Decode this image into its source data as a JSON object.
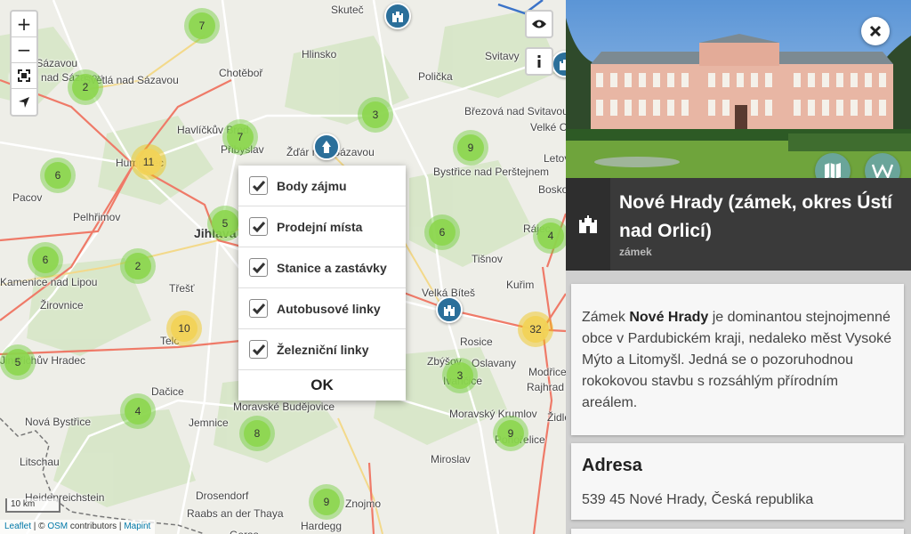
{
  "map": {
    "towns": [
      {
        "name": "Skuteč",
        "cls": ""
      },
      {
        "name": "nad Sázavou",
        "cls": ""
      },
      {
        "name": "Ledeč nad Sázavou",
        "cls": ""
      },
      {
        "name": "Světlá nad Sázavou",
        "cls": ""
      },
      {
        "name": "Chotěboř",
        "cls": ""
      },
      {
        "name": "Hlinsko",
        "cls": ""
      },
      {
        "name": "Polička",
        "cls": ""
      },
      {
        "name": "Svitavy",
        "cls": ""
      },
      {
        "name": "Havlíčkův Brod",
        "cls": ""
      },
      {
        "name": "Přibyslav",
        "cls": ""
      },
      {
        "name": "Žďár nad Sázavou",
        "cls": ""
      },
      {
        "name": "Březová nad Svitavou",
        "cls": ""
      },
      {
        "name": "Velké Opatovice",
        "cls": ""
      },
      {
        "name": "Humpolec",
        "cls": ""
      },
      {
        "name": "Bystřice nad Perštejnem",
        "cls": ""
      },
      {
        "name": "Letovice",
        "cls": ""
      },
      {
        "name": "Boskovice",
        "cls": ""
      },
      {
        "name": "Pacov",
        "cls": ""
      },
      {
        "name": "Pelhřimov",
        "cls": ""
      },
      {
        "name": "Jihlava",
        "cls": "big"
      },
      {
        "name": "Rájec",
        "cls": ""
      },
      {
        "name": "Tišnov",
        "cls": ""
      },
      {
        "name": "Kamenice nad Lipou",
        "cls": ""
      },
      {
        "name": "Žirovnice",
        "cls": ""
      },
      {
        "name": "Třešť",
        "cls": ""
      },
      {
        "name": "Velká Bíteš",
        "cls": ""
      },
      {
        "name": "Kuřim",
        "cls": ""
      },
      {
        "name": "Telč",
        "cls": ""
      },
      {
        "name": "Rosice",
        "cls": ""
      },
      {
        "name": "Jindřichův Hradec",
        "cls": ""
      },
      {
        "name": "Zbýšov",
        "cls": ""
      },
      {
        "name": "Oslavany",
        "cls": ""
      },
      {
        "name": "Modřice",
        "cls": ""
      },
      {
        "name": "Rajhrad",
        "cls": ""
      },
      {
        "name": "Dačice",
        "cls": ""
      },
      {
        "name": "Ivančice",
        "cls": ""
      },
      {
        "name": "Moravské Budějovice",
        "cls": ""
      },
      {
        "name": "Moravský Krumlov",
        "cls": ""
      },
      {
        "name": "Židlochovice",
        "cls": ""
      },
      {
        "name": "Nová Bystřice",
        "cls": ""
      },
      {
        "name": "Jemnice",
        "cls": ""
      },
      {
        "name": "Pohořelice",
        "cls": ""
      },
      {
        "name": "Litschau",
        "cls": ""
      },
      {
        "name": "Miroslav",
        "cls": ""
      },
      {
        "name": "Heidenreichstein",
        "cls": ""
      },
      {
        "name": "Drosendorf",
        "cls": ""
      },
      {
        "name": "Znojmo",
        "cls": ""
      },
      {
        "name": "Raabs an der Thaya",
        "cls": ""
      },
      {
        "name": "Hardegg",
        "cls": ""
      },
      {
        "name": "Geras",
        "cls": ""
      }
    ],
    "clusters": [
      {
        "count": "7",
        "color": "green"
      },
      {
        "count": "2",
        "color": "green"
      },
      {
        "count": "3",
        "color": "green"
      },
      {
        "count": "7",
        "color": "green"
      },
      {
        "count": "9",
        "color": "green"
      },
      {
        "count": "11",
        "color": "yellow"
      },
      {
        "count": "6",
        "color": "green"
      },
      {
        "count": "5",
        "color": "green"
      },
      {
        "count": "6",
        "color": "green"
      },
      {
        "count": "4",
        "color": "green"
      },
      {
        "count": "6",
        "color": "green"
      },
      {
        "count": "2",
        "color": "green"
      },
      {
        "count": "10",
        "color": "yellow"
      },
      {
        "count": "32",
        "color": "yellow"
      },
      {
        "count": "5",
        "color": "green"
      },
      {
        "count": "3",
        "color": "green"
      },
      {
        "count": "4",
        "color": "green"
      },
      {
        "count": "8",
        "color": "green"
      },
      {
        "count": "9",
        "color": "green"
      },
      {
        "count": "9",
        "color": "green"
      }
    ],
    "zoom_in": "+",
    "zoom_out": "−",
    "scale": "10 km",
    "attribution": {
      "leaflet": "Leaflet",
      "sep": " | © ",
      "osm": "OSM",
      "contributors": " contributors",
      "sep2": " | ",
      "mapint": "Mapint"
    }
  },
  "layers_popup": {
    "items": [
      {
        "label": "Body zájmu",
        "checked": true
      },
      {
        "label": "Prodejní místa",
        "checked": true
      },
      {
        "label": "Stanice a zastávky",
        "checked": true
      },
      {
        "label": "Autobusové linky",
        "checked": true
      },
      {
        "label": "Železniční linky",
        "checked": true
      }
    ],
    "ok": "OK"
  },
  "detail": {
    "title": "Nové Hrady (zámek, okres Ústí nad Orlicí)",
    "subtitle": "zámek",
    "description": {
      "before": "Zámek ",
      "bold": "Nové Hrady",
      "after": " je dominantou stejnojmenné obce v Pardubickém kraji, nedaleko měst Vysoké Mýto a Litomyšl. Jedná se o pozoruhodnou rokokovou stavbu s rozsáhlým přírodním areálem."
    },
    "address_heading": "Adresa",
    "address": "539 45 Nové Hrady, Česká republika"
  },
  "colors": {
    "rail": "#ef7a68",
    "cluster_green": "#8cd64e",
    "cluster_yellow": "#f1d357",
    "poi": "#2b6f9a",
    "panel": "#3a3a3a",
    "accent": "#6aa59a"
  }
}
